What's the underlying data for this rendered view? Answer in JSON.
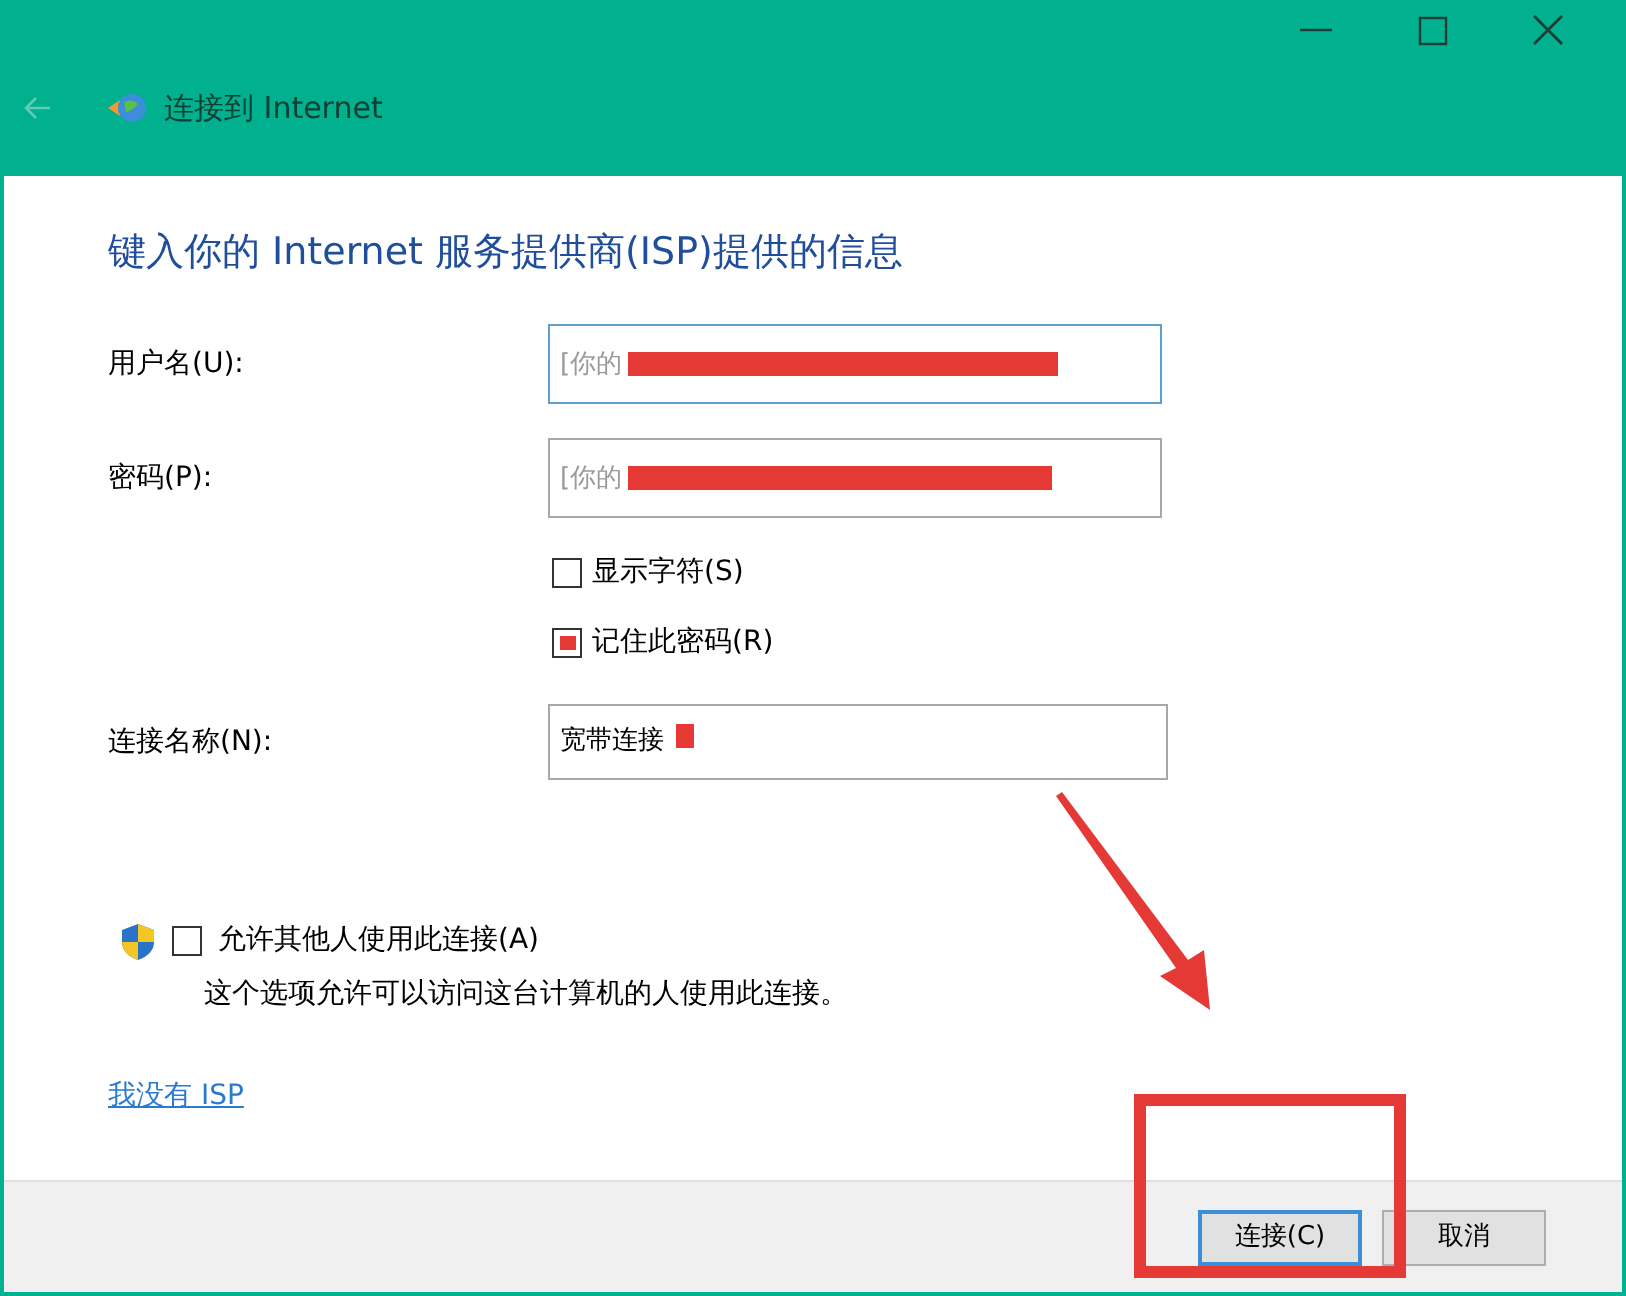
{
  "window": {
    "title": "连接到 Internet",
    "controls": [
      {
        "kind": "minimize"
      },
      {
        "kind": "maximize"
      },
      {
        "kind": "close"
      }
    ]
  },
  "heading": "键入你的 Internet 服务提供商(ISP)提供的信息",
  "fields": [
    {
      "label": "用户名(U):",
      "placeholder": "[你的",
      "focused": true,
      "redacted": true
    },
    {
      "label": "密码(P):",
      "placeholder": "[你的",
      "focused": false,
      "redacted": true
    }
  ],
  "checkboxes": [
    {
      "label": "显示字符(S)",
      "checked": false
    },
    {
      "label": "记住此密码(R)",
      "checked": true
    }
  ],
  "connection_name": {
    "label": "连接名称(N):",
    "value": "宽带连接",
    "redacted": true
  },
  "allow_others": {
    "label": "允许其他人使用此连接(A)",
    "checked": false,
    "description": "这个选项允许可以访问这台计算机的人使用此连接。"
  },
  "link": "我没有 ISP",
  "buttons": [
    {
      "label": "连接(C)",
      "highlighted": true
    },
    {
      "label": "取消",
      "highlighted": false
    }
  ],
  "annotations": {
    "arrow": true,
    "frame": true
  }
}
